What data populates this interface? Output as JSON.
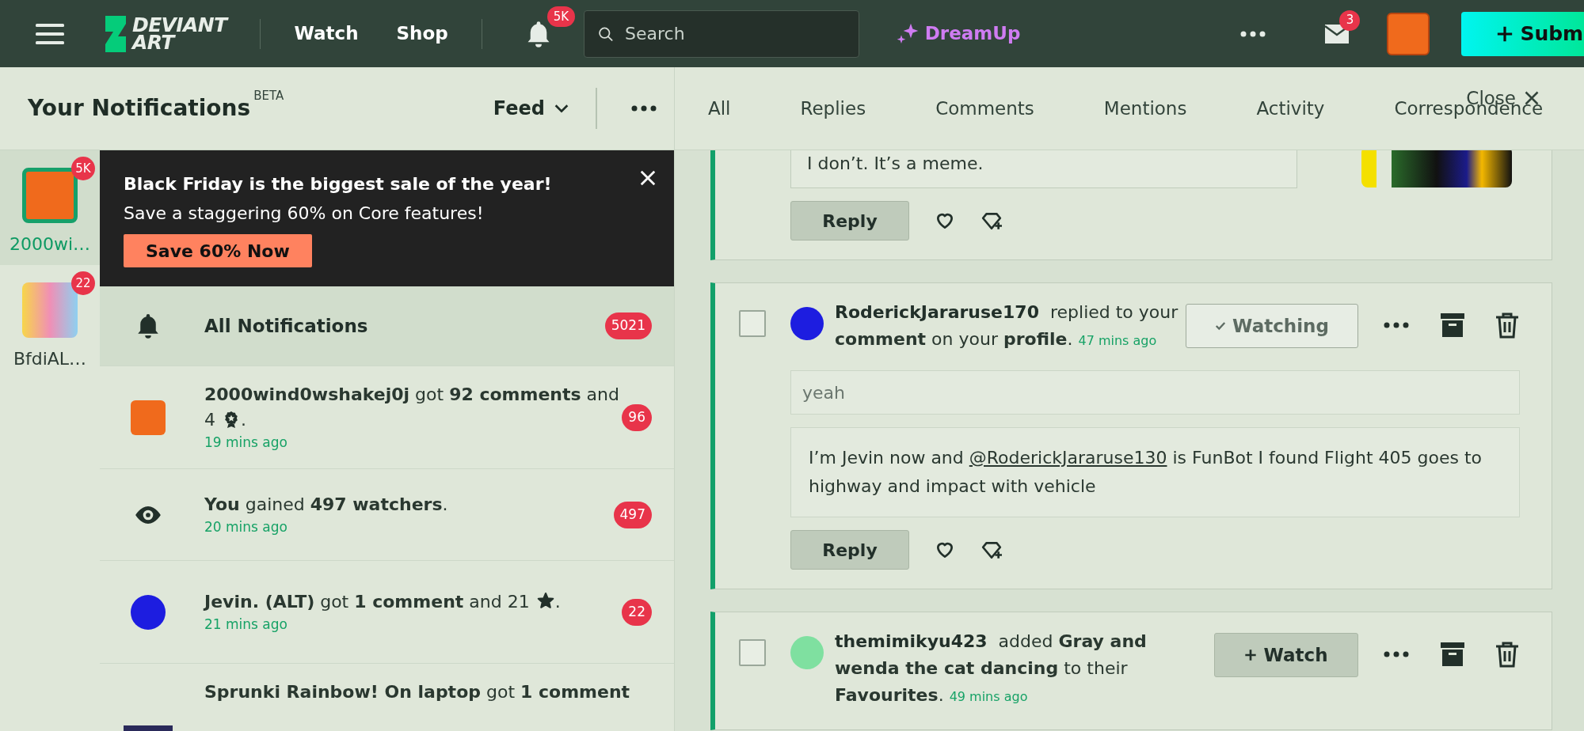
{
  "topbar": {
    "logo": [
      "DEVIANT",
      "ART"
    ],
    "nav": [
      "Watch",
      "Shop"
    ],
    "bell_badge": "5K",
    "search": {
      "placeholder": "Search"
    },
    "dreamup": "DreamUp",
    "mail_badge": "3",
    "submit": "Subm"
  },
  "header": {
    "title": "Your Notifications",
    "tag": "BETA",
    "feed": "Feed",
    "close": "Close"
  },
  "tabs": [
    {
      "label": "All"
    },
    {
      "label": "Replies"
    },
    {
      "label": "Comments"
    },
    {
      "label": "Mentions"
    },
    {
      "label": "Activity"
    },
    {
      "label": "Correspondence"
    }
  ],
  "accounts": [
    {
      "name": "2000wi…",
      "badge": "5K",
      "selected": true
    },
    {
      "name": "BfdiAL…",
      "badge": "22",
      "selected": false
    }
  ],
  "banner": {
    "title": "Black Friday is the biggest sale of the year!",
    "text": "Save a staggering 60% on Core features!",
    "button": "Save 60% Now"
  },
  "notifications": [
    {
      "kind": "all",
      "text": "All Notifications",
      "count": "5021",
      "selected": true
    },
    {
      "kind": "avatar",
      "text": "**2000wind0wshakej0j** got **92 comments** and 4",
      "inline_icon": {
        "kind": "award"
      },
      "end": ".",
      "time": "19 mins ago",
      "count": "96",
      "selected": false
    },
    {
      "kind": "eye",
      "text": "**You** gained **497 watchers**.",
      "time": "20 mins ago",
      "count": "497",
      "selected": false
    },
    {
      "kind": "avatar",
      "text": "**Jevin. (ALT)** got **1 comment** and 21",
      "inline_icon": {
        "kind": "star"
      },
      "end": ".",
      "time": "21 mins ago",
      "count": "22",
      "selected": false
    },
    {
      "kind": "thumb",
      "text": "**Sprunki Rainbow! On laptop** got **1 comment**",
      "selected": false
    }
  ],
  "cards": [
    {
      "kind": "partial",
      "comment": "I don’t. It’s a meme.",
      "reply": "Reply"
    },
    {
      "kind": "full",
      "checked": false,
      "user": "RoderickJararuse170",
      "action": "replied to your **comment** on your **profile**.",
      "time": "47 mins ago",
      "watch": {
        "label": "Watching",
        "watching": true
      },
      "quote": "yeah",
      "comment": {
        "before": "I’m Jevin now and ",
        "mention": "@RoderickJararuse130",
        "after": " is FunBot I found Flight 405 goes to highway and impact with vehicle"
      },
      "reply": "Reply"
    },
    {
      "kind": "full",
      "checked": false,
      "user": "themimikyu423",
      "action": "added **Gray and wenda the cat dancing** to their **Favourites**.",
      "time": "49 mins ago",
      "watch": {
        "label": "Watch",
        "watching": false
      }
    }
  ]
}
